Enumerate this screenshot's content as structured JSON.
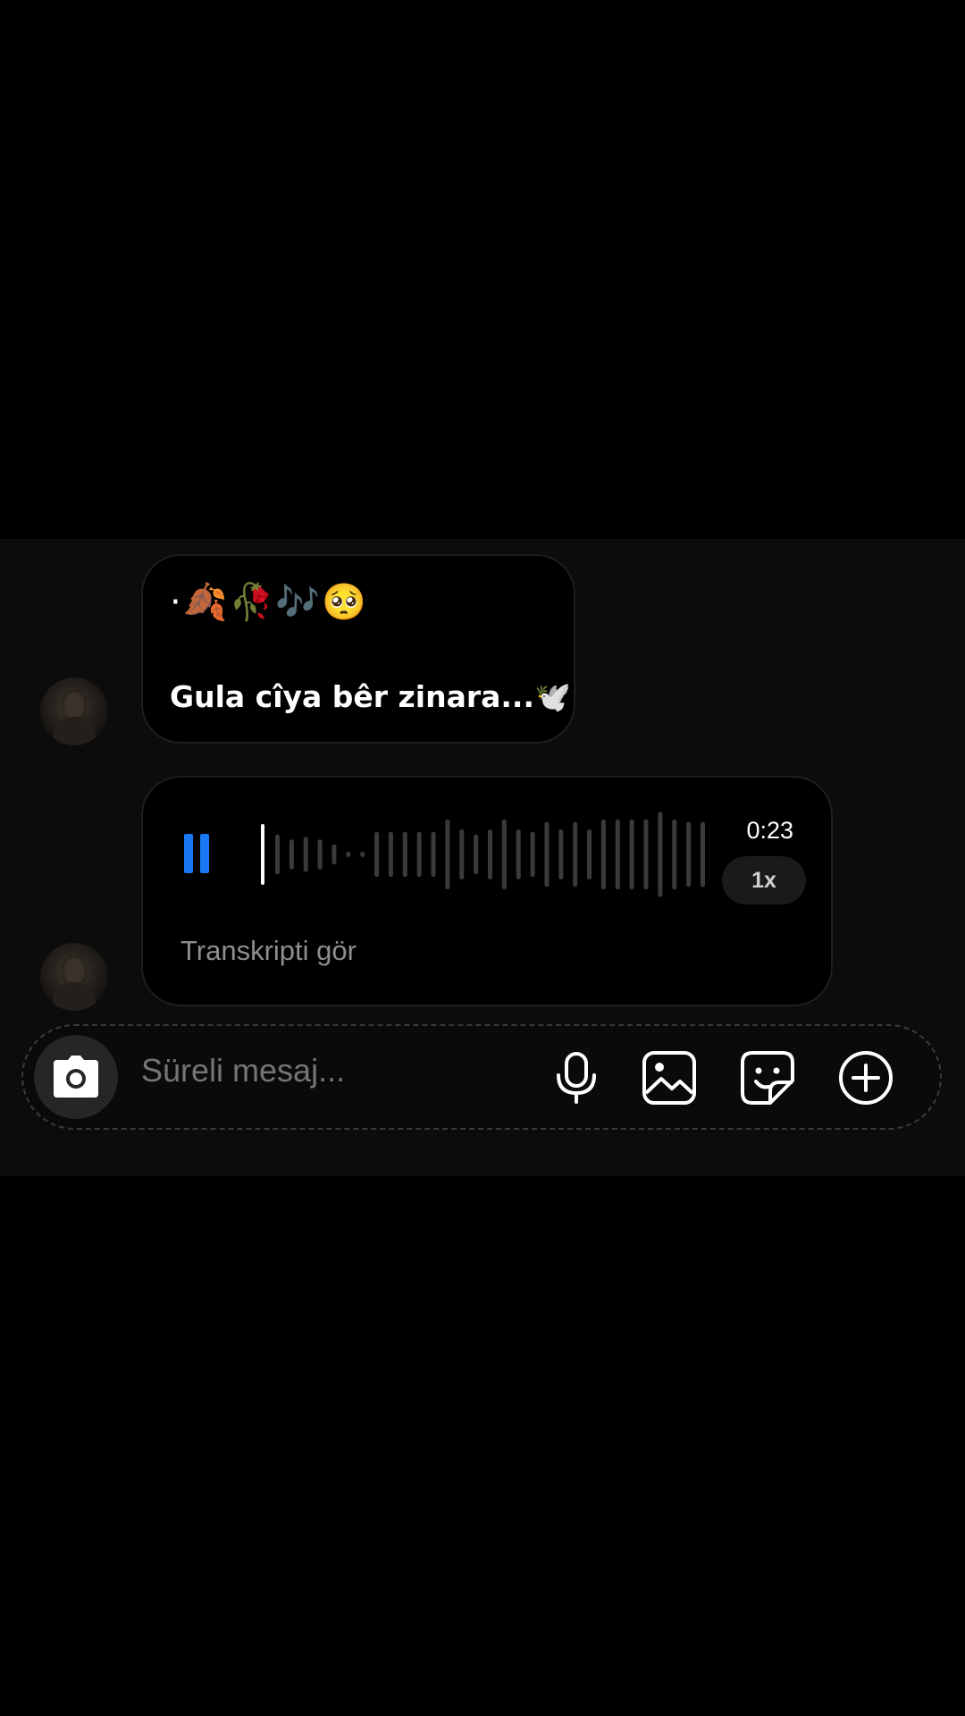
{
  "conversation": {
    "messages": [
      {
        "type": "text",
        "emoji_line": "·🍂🥀🎶🥺",
        "text": "Gula cîya bêr zinara...🕊️"
      },
      {
        "type": "voice",
        "duration": "0:23",
        "playback_speed": "1x",
        "transcript_label": "Transkripti gör",
        "state": "playing",
        "progress_fraction": 0.0,
        "waveform_levels": [
          0.4,
          0.3,
          0.35,
          0.3,
          0.2,
          0.05,
          0.05,
          0.45,
          0.45,
          0.45,
          0.45,
          0.45,
          0.7,
          0.5,
          0.4,
          0.5,
          0.7,
          0.5,
          0.45,
          0.65,
          0.5,
          0.65,
          0.5,
          0.7,
          0.7,
          0.7,
          0.7,
          0.85,
          0.7,
          0.65,
          0.65
        ]
      }
    ]
  },
  "composer": {
    "placeholder": "Süreli mesaj..."
  },
  "icons": {
    "camera": "camera-icon",
    "microphone": "microphone-icon",
    "gallery": "gallery-icon",
    "sticker": "sticker-icon",
    "add": "plus-circle-icon",
    "pause": "pause-icon"
  },
  "colors": {
    "accent": "#1877f2",
    "background": "#000000",
    "panel": "#0c0c0c",
    "waveform_played": "#ffffff",
    "waveform_unplayed": "#3a3a3a"
  }
}
